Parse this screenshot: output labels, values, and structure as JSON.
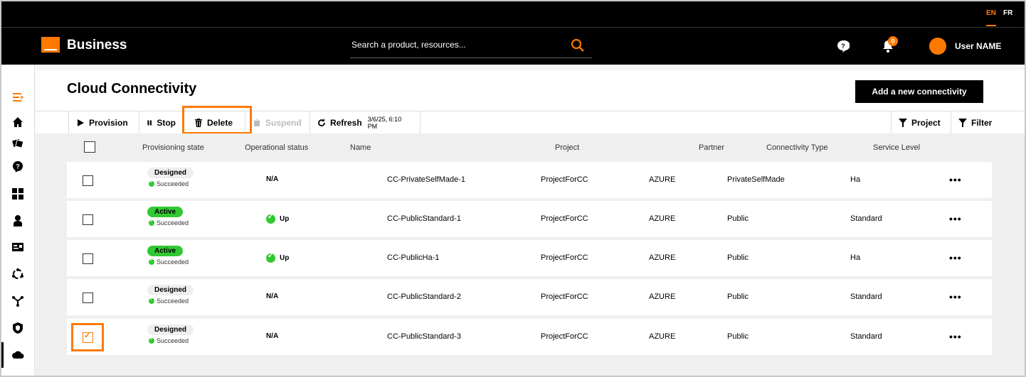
{
  "lang": {
    "en": "EN",
    "fr": "FR"
  },
  "header": {
    "brand": "Business",
    "search_placeholder": "Search a product, resources...",
    "notification_count": "0",
    "username": "User NAME"
  },
  "sidebar": {
    "icons": [
      "menu-icon",
      "home-icon",
      "catalog-icon",
      "support-icon",
      "dashboard-icon",
      "user-icon",
      "billing-icon",
      "network-icon",
      "topology-icon",
      "security-icon",
      "cloud-icon"
    ]
  },
  "page": {
    "title": "Cloud Connectivity",
    "add_button": "Add a new connectivity"
  },
  "toolbar": {
    "provision": "Provision",
    "stop": "Stop",
    "delete": "Delete",
    "suspend": "Suspend",
    "refresh": "Refresh",
    "refresh_time": "3/6/25, 6:10 PM",
    "project": "Project",
    "filter": "Filter"
  },
  "table": {
    "columns": {
      "provisioning_state": "Provisioning state",
      "operational_status": "Operational status",
      "name": "Name",
      "project": "Project",
      "partner": "Partner",
      "connectivity_type": "Connectivity Type",
      "service_level": "Service Level"
    },
    "rows": [
      {
        "state": "Designed",
        "state_kind": "designed",
        "sub": "Succeeded",
        "op": "N/A",
        "op_up": false,
        "name": "CC-PrivateSelfMade-1",
        "project": "ProjectForCC",
        "partner": "AZURE",
        "type": "PrivateSelfMade",
        "level": "Ha",
        "checked": false
      },
      {
        "state": "Active",
        "state_kind": "active",
        "sub": "Succeeded",
        "op": "Up",
        "op_up": true,
        "name": "CC-PublicStandard-1",
        "project": "ProjectForCC",
        "partner": "AZURE",
        "type": "Public",
        "level": "Standard",
        "checked": false
      },
      {
        "state": "Active",
        "state_kind": "active",
        "sub": "Succeeded",
        "op": "Up",
        "op_up": true,
        "name": "CC-PublicHa-1",
        "project": "ProjectForCC",
        "partner": "AZURE",
        "type": "Public",
        "level": "Ha",
        "checked": false
      },
      {
        "state": "Designed",
        "state_kind": "designed",
        "sub": "Succeeded",
        "op": "N/A",
        "op_up": false,
        "name": "CC-PublicStandard-2",
        "project": "ProjectForCC",
        "partner": "AZURE",
        "type": "Public",
        "level": "Standard",
        "checked": false
      },
      {
        "state": "Designed",
        "state_kind": "designed",
        "sub": "Succeeded",
        "op": "N/A",
        "op_up": false,
        "name": "CC-PublicStandard-3",
        "project": "ProjectForCC",
        "partner": "AZURE",
        "type": "Public",
        "level": "Standard",
        "checked": true
      }
    ],
    "more_label": "•••"
  },
  "colors": {
    "accent": "#ff7900",
    "success": "#32c832",
    "header_bg": "#000000"
  }
}
